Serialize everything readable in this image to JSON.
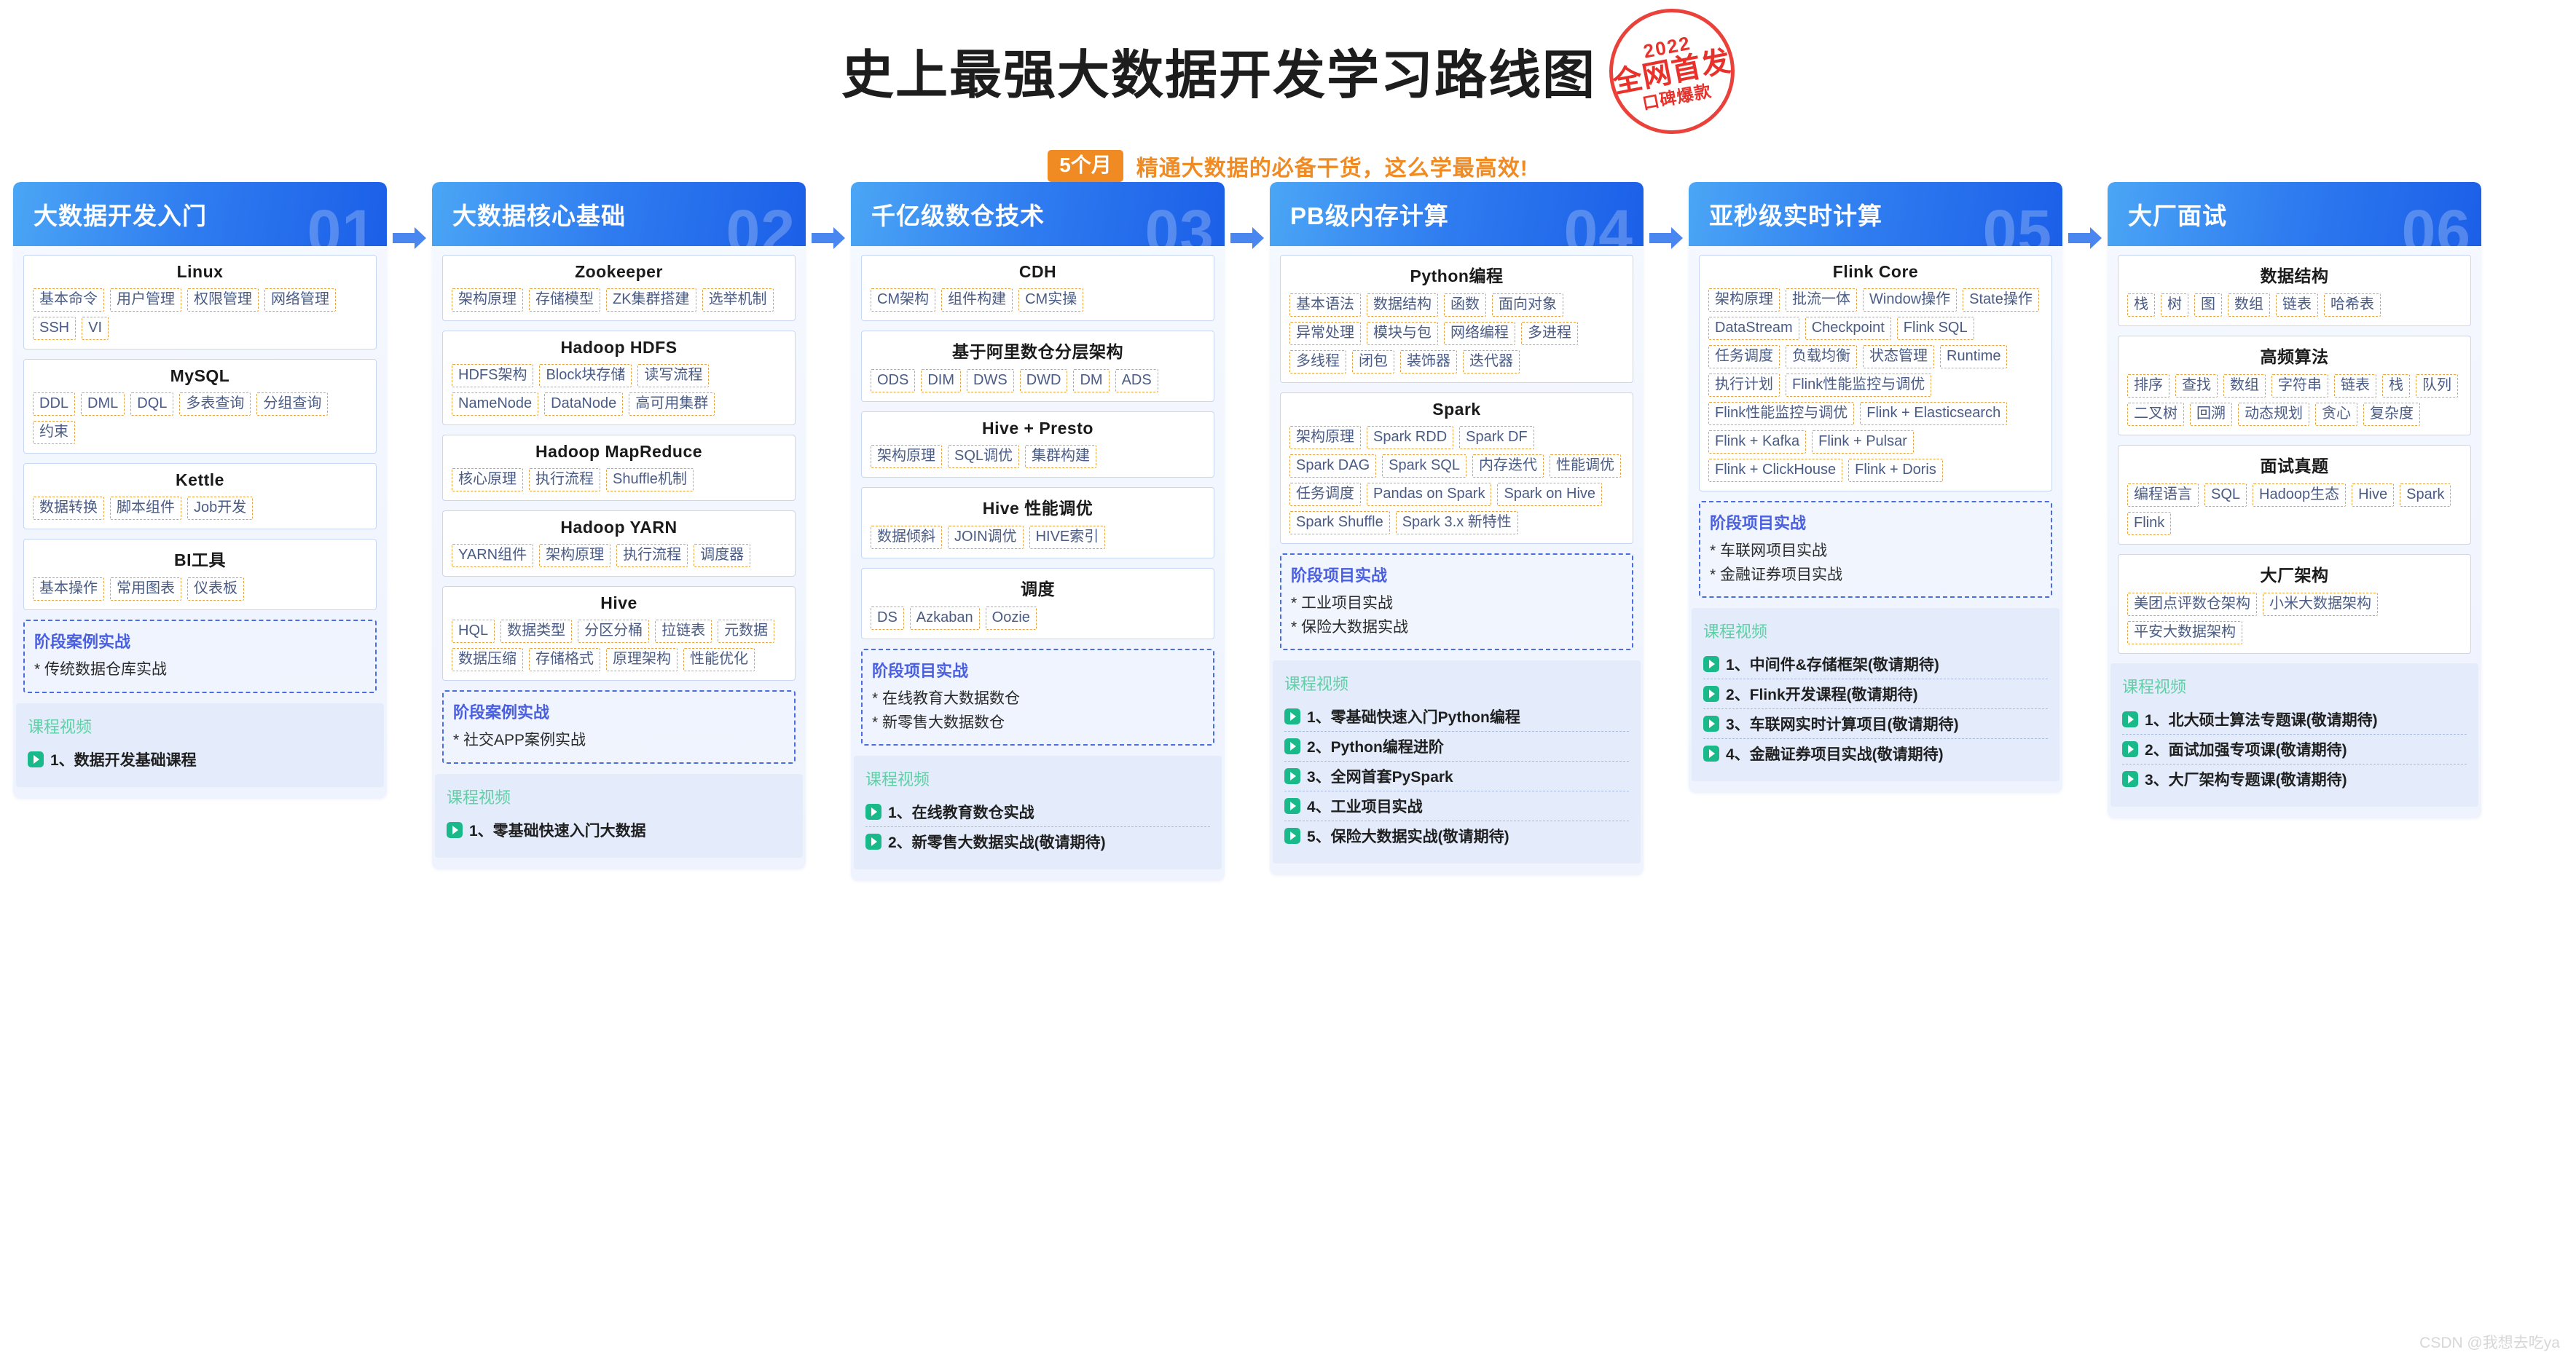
{
  "header": {
    "title": "史上最强大数据开发学习路线图",
    "badge_months": "5个月",
    "subtitle": "精通大数据的必备干货，这么学最高效!",
    "stamp": {
      "year": "2022",
      "main": "全网首发",
      "sub": "口碑爆款"
    }
  },
  "watermark": "CSDN @我想去吃ya",
  "columns": [
    {
      "number": "01",
      "title": "大数据开发入门",
      "cards": [
        {
          "title": "Linux",
          "tags": [
            "基本命令",
            "用户管理",
            "权限管理",
            "网络管理",
            "SSH",
            "VI"
          ]
        },
        {
          "title": "MySQL",
          "tags": [
            "DDL",
            "DML",
            "DQL",
            "多表查询",
            "分组查询",
            "约束"
          ]
        },
        {
          "title": "Kettle",
          "tags": [
            "数据转换",
            "脚本组件",
            "Job开发"
          ]
        },
        {
          "title": "BI工具",
          "tags": [
            "基本操作",
            "常用图表",
            "仪表板"
          ]
        }
      ],
      "practice": {
        "title": "阶段案例实战",
        "items": [
          "* 传统数据仓库实战"
        ]
      },
      "videos": {
        "title": "课程视频",
        "items": [
          "1、数据开发基础课程"
        ]
      }
    },
    {
      "number": "02",
      "title": "大数据核心基础",
      "cards": [
        {
          "title": "Zookeeper",
          "tags": [
            "架构原理",
            "存储模型",
            "ZK集群搭建",
            "选举机制"
          ]
        },
        {
          "title": "Hadoop HDFS",
          "tags": [
            "HDFS架构",
            "Block块存储",
            "读写流程",
            "NameNode",
            "DataNode",
            "高可用集群"
          ]
        },
        {
          "title": "Hadoop MapReduce",
          "tags": [
            "核心原理",
            "执行流程",
            "Shuffle机制"
          ]
        },
        {
          "title": "Hadoop YARN",
          "tags": [
            "YARN组件",
            "架构原理",
            "执行流程",
            "调度器"
          ]
        },
        {
          "title": "Hive",
          "tags": [
            "HQL",
            "数据类型",
            "分区分桶",
            "拉链表",
            "元数据",
            "数据压缩",
            "存储格式",
            "原理架构",
            "性能优化"
          ]
        }
      ],
      "practice": {
        "title": "阶段案例实战",
        "items": [
          "* 社交APP案例实战"
        ]
      },
      "videos": {
        "title": "课程视频",
        "items": [
          "1、零基础快速入门大数据"
        ]
      }
    },
    {
      "number": "03",
      "title": "千亿级数仓技术",
      "cards": [
        {
          "title": "CDH",
          "tags": [
            "CM架构",
            "组件构建",
            "CM实操"
          ]
        },
        {
          "title": "基于阿里数仓分层架构",
          "tags": [
            "ODS",
            "DIM",
            "DWS",
            "DWD",
            "DM",
            "ADS"
          ]
        },
        {
          "title": "Hive + Presto",
          "tags": [
            "架构原理",
            "SQL调优",
            "集群构建"
          ]
        },
        {
          "title": "Hive 性能调优",
          "tags": [
            "数据倾斜",
            "JOIN调优",
            "HIVE索引"
          ]
        },
        {
          "title": "调度",
          "tags": [
            "DS",
            "Azkaban",
            "Oozie"
          ]
        }
      ],
      "practice": {
        "title": "阶段项目实战",
        "items": [
          "* 在线教育大数据数仓",
          "* 新零售大数据数仓"
        ]
      },
      "videos": {
        "title": "课程视频",
        "items": [
          "1、在线教育数仓实战",
          "2、新零售大数据实战(敬请期待)"
        ]
      }
    },
    {
      "number": "04",
      "title": "PB级内存计算",
      "cards": [
        {
          "title": "Python编程",
          "tags": [
            "基本语法",
            "数据结构",
            "函数",
            "面向对象",
            "异常处理",
            "模块与包",
            "网络编程",
            "多进程",
            "多线程",
            "闭包",
            "装饰器",
            "迭代器"
          ]
        },
        {
          "title": "Spark",
          "tags": [
            "架构原理",
            "Spark RDD",
            "Spark DF",
            "Spark DAG",
            "Spark SQL",
            "内存迭代",
            "性能调优",
            "任务调度",
            "Pandas on Spark",
            "Spark on Hive",
            "Spark Shuffle",
            "Spark 3.x 新特性"
          ]
        }
      ],
      "practice": {
        "title": "阶段项目实战",
        "items": [
          "* 工业项目实战",
          "* 保险大数据实战"
        ]
      },
      "videos": {
        "title": "课程视频",
        "items": [
          "1、零基础快速入门Python编程",
          "2、Python编程进阶",
          "3、全网首套PySpark",
          "4、工业项目实战",
          "5、保险大数据实战(敬请期待)"
        ]
      }
    },
    {
      "number": "05",
      "title": "亚秒级实时计算",
      "cards": [
        {
          "title": "Flink Core",
          "tags": [
            "架构原理",
            "批流一体",
            "Window操作",
            "State操作",
            "DataStream",
            "Checkpoint",
            "Flink SQL",
            "任务调度",
            "负载均衡",
            "状态管理",
            "Runtime",
            "执行计划",
            "Flink性能监控与调优",
            "Flink性能监控与调优",
            "Flink + Elasticsearch",
            "Flink + Kafka",
            "Flink + Pulsar",
            "Flink + ClickHouse",
            "Flink + Doris"
          ]
        }
      ],
      "practice": {
        "title": "阶段项目实战",
        "items": [
          "* 车联网项目实战",
          "* 金融证券项目实战"
        ]
      },
      "videos": {
        "title": "课程视频",
        "items": [
          "1、中间件&存储框架(敬请期待)",
          "2、Flink开发课程(敬请期待)",
          "3、车联网实时计算项目(敬请期待)",
          "4、金融证券项目实战(敬请期待)"
        ]
      }
    },
    {
      "number": "06",
      "title": "大厂面试",
      "cards": [
        {
          "title": "数据结构",
          "tags": [
            "栈",
            "树",
            "图",
            "数组",
            "链表",
            "哈希表"
          ]
        },
        {
          "title": "高频算法",
          "tags": [
            "排序",
            "查找",
            "数组",
            "字符串",
            "链表",
            "栈",
            "队列",
            "二叉树",
            "回溯",
            "动态规划",
            "贪心",
            "复杂度"
          ]
        },
        {
          "title": "面试真题",
          "tags": [
            "编程语言",
            "SQL",
            "Hadoop生态",
            "Hive",
            "Spark",
            "Flink"
          ]
        },
        {
          "title": "大厂架构",
          "tags": [
            "美团点评数仓架构",
            "小米大数据架构",
            "平安大数据架构"
          ]
        }
      ],
      "practice": null,
      "videos": {
        "title": "课程视频",
        "items": [
          "1、北大硕士算法专题课(敬请期待)",
          "2、面试加强专项课(敬请期待)",
          "3、大厂架构专题课(敬请期待)"
        ]
      }
    }
  ]
}
